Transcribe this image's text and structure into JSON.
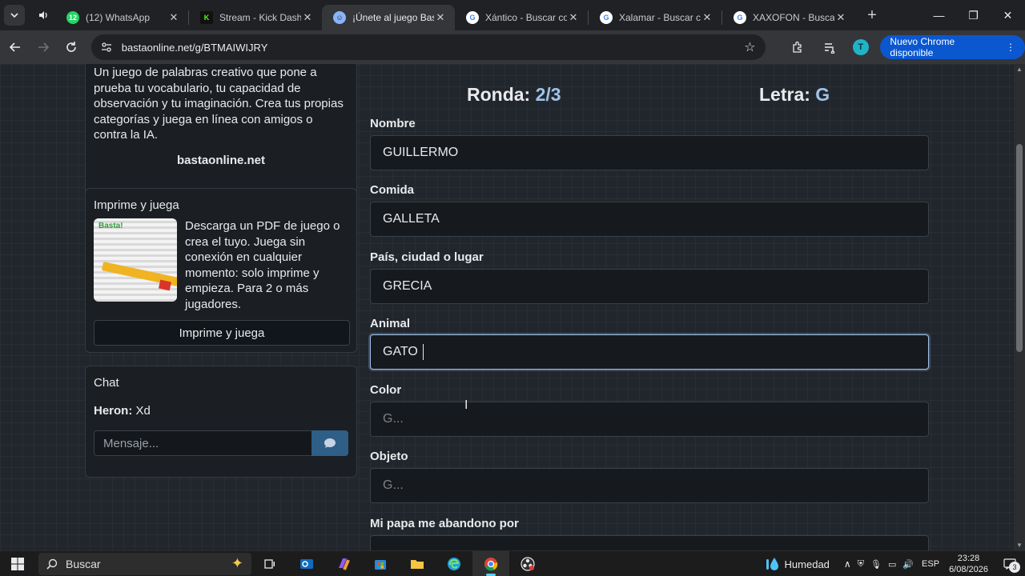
{
  "browser": {
    "tabs": [
      {
        "title": "(12) WhatsApp",
        "favicon_text": "12",
        "favicon_color": "#25d366",
        "active": false
      },
      {
        "title": "Stream - Kick Dashb",
        "favicon_text": "K",
        "favicon_color": "#53fc18",
        "active": false
      },
      {
        "title": "¡Únete al juego Bast",
        "favicon_text": "",
        "favicon_color": "#8ab4f8",
        "active": true
      },
      {
        "title": "Xántico - Buscar co",
        "favicon_text": "G",
        "favicon_color": "#4285f4",
        "active": false
      },
      {
        "title": "Xalamar - Buscar co",
        "favicon_text": "G",
        "favicon_color": "#4285f4",
        "active": false
      },
      {
        "title": "XAXOFON - Buscar",
        "favicon_text": "G",
        "favicon_color": "#4285f4",
        "active": false
      }
    ],
    "url": "bastaonline.net/g/BTMAIWIJRY",
    "update_label": "Nuevo Chrome disponible",
    "profile_initial": "T"
  },
  "sidebar": {
    "about": {
      "description": "Un juego de palabras creativo que pone a prueba tu vocabulario, tu capacidad de observación y tu imaginación. Crea tus propias categorías y juega en línea con amigos o contra la IA.",
      "site": "bastaonline.net"
    },
    "print": {
      "heading": "Imprime y juega",
      "thumbnail_logo": "Basta!",
      "text": "Descarga un PDF de juego o crea el tuyo. Juega sin conexión en cualquier momento: solo imprime y empieza. Para 2 o más jugadores.",
      "button_label": "Imprime y juega"
    },
    "chat": {
      "heading": "Chat",
      "messages": [
        {
          "author": "Heron:",
          "text": "Xd"
        }
      ],
      "input_placeholder": "Mensaje..."
    }
  },
  "game": {
    "round_label": "Ronda:",
    "round_value": "2/3",
    "letter_label": "Letra:",
    "letter_value": "G",
    "fields": [
      {
        "label": "Nombre",
        "value": "GUILLERMO",
        "placeholder": ""
      },
      {
        "label": "Comida",
        "value": "GALLETA",
        "placeholder": ""
      },
      {
        "label": "País, ciudad o lugar",
        "value": "GRECIA",
        "placeholder": ""
      },
      {
        "label": "Animal",
        "value": "GATO ",
        "placeholder": "",
        "focused": true
      },
      {
        "label": "Color",
        "value": "",
        "placeholder": "G..."
      },
      {
        "label": "Objeto",
        "value": "",
        "placeholder": "G..."
      },
      {
        "label": "Mi papa me abandono por",
        "value": "",
        "placeholder": ""
      }
    ]
  },
  "taskbar": {
    "search_label": "Buscar",
    "weather_label": "Humedad",
    "language": "ESP",
    "time": "23:28",
    "date": "6/08/2026",
    "notification_count": "3"
  }
}
